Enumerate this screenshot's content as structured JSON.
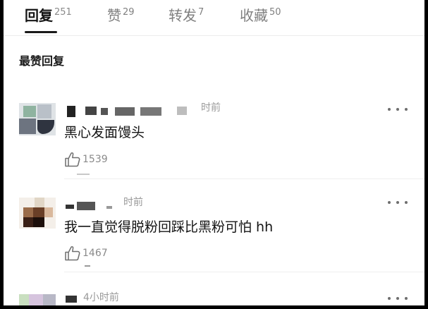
{
  "tabs": [
    {
      "label": "回复",
      "count": "251",
      "active": true
    },
    {
      "label": "赞",
      "count": "29",
      "active": false
    },
    {
      "label": "转发",
      "count": "7",
      "active": false
    },
    {
      "label": "收藏",
      "count": "50",
      "active": false
    }
  ],
  "section_title": "最赞回复",
  "comments": [
    {
      "time": "时前",
      "text": "黑心发面馒头",
      "likes": "1539",
      "more_icon": "more-horizontal-icon",
      "like_icon": "thumbs-up-icon"
    },
    {
      "time": "时前",
      "text": "我一直觉得脱粉回踩比黑粉可怕 hh",
      "likes": "1467",
      "more_icon": "more-horizontal-icon",
      "like_icon": "thumbs-up-icon"
    },
    {
      "time": "4小时前",
      "text": "",
      "likes": "",
      "more_icon": "more-horizontal-icon",
      "like_icon": "thumbs-up-icon"
    }
  ],
  "colors": {
    "active_tab": "#151515",
    "inactive_tab": "#7f7f7f",
    "meta_text": "#9a9a9a",
    "frame": "#000000"
  }
}
